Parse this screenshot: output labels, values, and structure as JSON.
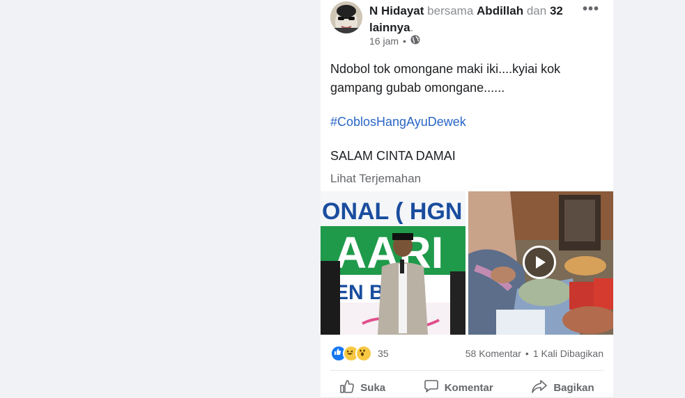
{
  "post": {
    "author": "N Hidayat",
    "with_word": "bersama",
    "tagged": "Abdillah",
    "and_word": "dan",
    "others": "32 lainnya",
    "period": ".",
    "time": "16 jam",
    "dot": "•",
    "privacy_icon": "globe-icon",
    "more": "•••",
    "text_line1": "Ndobol tok omongane maki iki....kyiai kok gampang gubab omongane......",
    "hashtag": "#CoblosHangAyuDewek",
    "text_line3": "SALAM CINTA DAMAI",
    "translate": "Lihat Terjemahan",
    "media": {
      "left_banner_text": "ONAL ( HGN ) T",
      "left_banner_text2": "AARI",
      "left_banner_text3": "EN B    UW",
      "right_play_icon": "play-icon"
    }
  },
  "stats": {
    "reaction_icons": [
      "like-icon",
      "haha-icon",
      "wow-icon"
    ],
    "reaction_count": "35",
    "comments": "58 Komentar",
    "sep": "•",
    "shares": "1 Kali Dibagikan"
  },
  "actions": {
    "like": "Suka",
    "comment": "Komentar",
    "share": "Bagikan"
  },
  "colors": {
    "background": "#f0f2f5",
    "hashtag": "#2a66c6",
    "like_blue": "#1877f2"
  }
}
